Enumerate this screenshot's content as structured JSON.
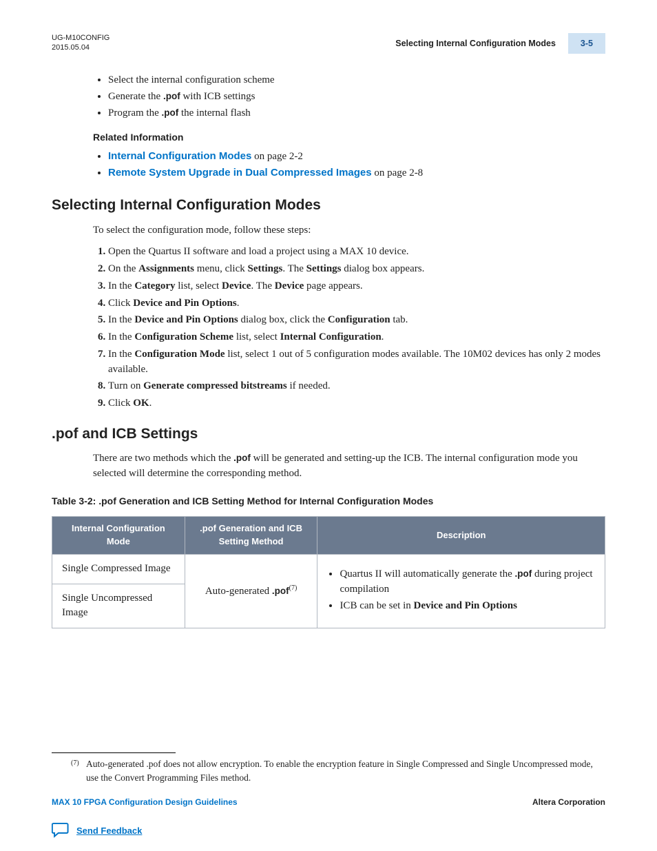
{
  "header": {
    "doc_id": "UG-M10CONFIG",
    "date": "2015.05.04",
    "section_title": "Selecting Internal Configuration Modes",
    "page_number": "3-5"
  },
  "top_bullets": [
    "Select the internal configuration scheme",
    "Generate the __POF__ with ICB settings",
    "Program the __POF__ the internal flash"
  ],
  "related_info_label": "Related Information",
  "related_links": [
    {
      "text": "Internal Configuration Modes",
      "suffix": " on page 2-2"
    },
    {
      "text": "Remote System Upgrade in Dual Compressed Images",
      "suffix": " on page 2-8"
    }
  ],
  "heading1": "Selecting Internal Configuration Modes",
  "intro1": "To select the configuration mode, follow these steps:",
  "steps": [
    "Open the Quartus II software and load a project using a MAX 10 device.",
    "On the __B__Assignments__/B__ menu, click __B__Settings__/B__. The __B__Settings__/B__ dialog box appears.",
    "In the __B__Category__/B__ list, select __B__Device__/B__. The __B__Device__/B__ page appears.",
    "Click __B__Device and Pin Options__/B__.",
    "In the __B__Device and Pin Options__/B__ dialog box, click the __B__Configuration__/B__ tab.",
    "In the __B__Configuration Scheme__/B__ list, select __B__Internal Configuration__/B__.",
    "In the __B__Configuration Mode__/B__ list, select 1 out of 5 configuration modes available. The 10M02 devices has only 2 modes available.",
    "Turn on __B__Generate compressed bitstreams__/B__ if needed.",
    "Click __B__OK__/B__."
  ],
  "heading2": ".pof and ICB Settings",
  "intro2": "There are two methods which the __POF__ will be generated and setting-up the ICB. The internal configuration mode you selected will determine the corresponding method.",
  "table_caption": "Table 3-2: .pof Generation and ICB Setting Method for Internal Configuration Modes",
  "table": {
    "headers": [
      "Internal Configuration Mode",
      ".pof Generation and ICB Setting Method",
      "Description"
    ],
    "col1": [
      "Single Compressed Image",
      "Single Uncompressed Image"
    ],
    "col2": "Auto-generated __POF__",
    "col2_sup": "(7)",
    "col3": [
      "Quartus II will automatically generate the __POF__ during project compilation",
      "ICB can be set in __B__Device and Pin Options__/B__"
    ]
  },
  "footnote_marker": "(7)",
  "footnote_text": "Auto-generated .pof does not allow encryption. To enable the encryption feature in Single Compressed and Single Uncompressed mode, use the Convert Programming Files method.",
  "footer": {
    "left": "MAX 10 FPGA Configuration Design Guidelines",
    "right": "Altera Corporation",
    "feedback": "Send Feedback"
  }
}
